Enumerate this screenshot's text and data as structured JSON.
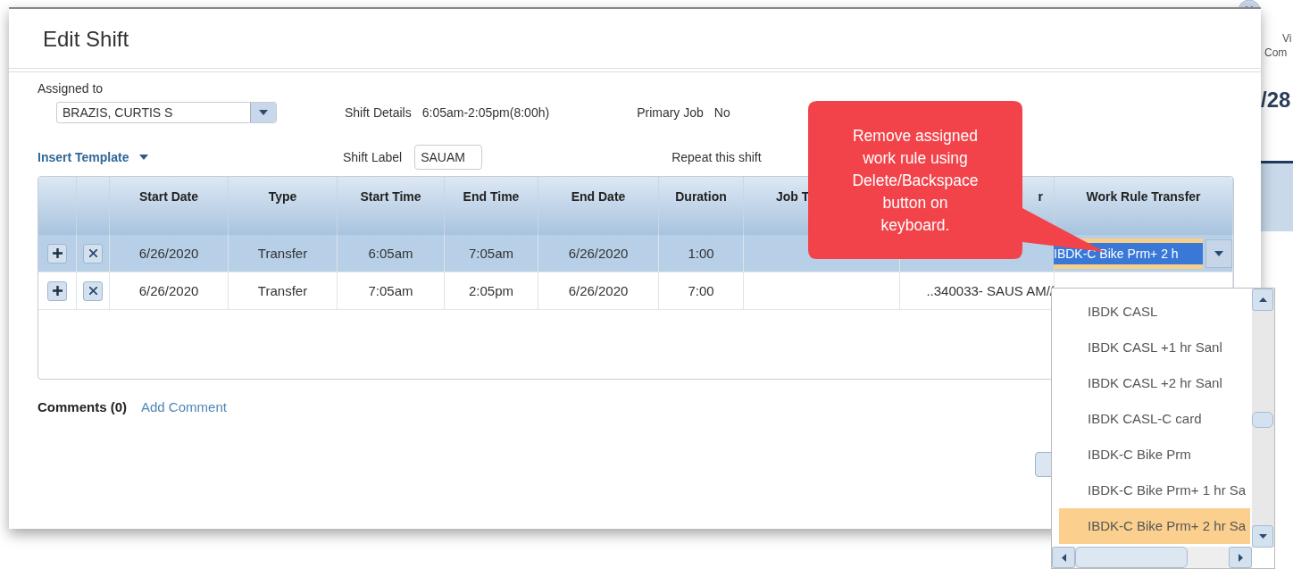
{
  "background": {
    "texts": [
      "Vi",
      "Com",
      "/28"
    ]
  },
  "dialog": {
    "title": "Edit Shift"
  },
  "assigned_to": {
    "label": "Assigned to",
    "value": "BRAZIS, CURTIS S"
  },
  "shift_details": {
    "label": "Shift Details",
    "value": "6:05am-2:05pm(8:00h)"
  },
  "primary_job": {
    "label": "Primary Job",
    "value": "No"
  },
  "insert_template": {
    "label": "Insert Template"
  },
  "shift_label": {
    "label": "Shift Label",
    "value": "SAUAM"
  },
  "repeat_shift": {
    "label": "Repeat this shift"
  },
  "table": {
    "columns": [
      "Start Date",
      "Type",
      "Start Time",
      "End Time",
      "End Date",
      "Duration",
      "Job T",
      "r",
      "Work Rule Transfer"
    ],
    "rows": [
      {
        "selected": true,
        "cells": [
          "6/26/2020",
          "Transfer",
          "6:05am",
          "7:05am",
          "6/26/2020",
          "1:00"
        ],
        "work_rule": "IBDK-C Bike Prm+ 2 h"
      },
      {
        "selected": false,
        "cells": [
          "6/26/2020",
          "Transfer",
          "7:05am",
          "2:05pm",
          "6/26/2020",
          "7:00"
        ],
        "column_10": "..340033- SAUS AM//"
      }
    ]
  },
  "comments": {
    "label": "Comments (0)",
    "link": "Add Comment"
  },
  "work_rule_list": {
    "items": [
      {
        "label": "IBDK CASL",
        "selected": false
      },
      {
        "label": "IBDK CASL +1 hr Sanl",
        "selected": false
      },
      {
        "label": "IBDK CASL +2 hr Sanl",
        "selected": false
      },
      {
        "label": "IBDK CASL-C card",
        "selected": false
      },
      {
        "label": "IBDK-C Bike Prm",
        "selected": false
      },
      {
        "label": "IBDK-C Bike Prm+ 1 hr Sa",
        "selected": false
      },
      {
        "label": "IBDK-C Bike Prm+ 2 hr Sa",
        "selected": true
      }
    ]
  },
  "callout": {
    "text": "Remove assigned work rule using Delete/Backspace button on keyboard."
  }
}
